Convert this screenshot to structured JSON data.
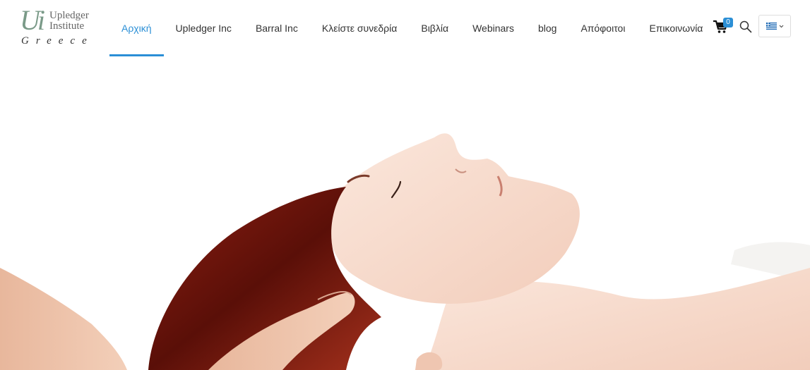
{
  "logo": {
    "mark": "Ui",
    "line1": "Upledger",
    "line2": "Institute",
    "country": "Greece"
  },
  "nav": {
    "items": [
      {
        "label": "Αρχική",
        "active": true
      },
      {
        "label": "Upledger Inc"
      },
      {
        "label": "Barral Inc"
      },
      {
        "label": "Κλείστε συνεδρία"
      },
      {
        "label": "Βιβλία"
      },
      {
        "label": "Webinars"
      },
      {
        "label": "blog"
      },
      {
        "label": "Απόφοιτοι"
      },
      {
        "label": "Επικοινωνία"
      }
    ]
  },
  "header_actions": {
    "cart_icon": "shopping-cart-icon",
    "cart_count": "0",
    "search_icon": "search-icon",
    "language_icon": "greek-flag-icon"
  },
  "hero": {
    "image": "woman-receiving-craniosacral-head-massage",
    "accent_color": "#2b8fd6"
  }
}
